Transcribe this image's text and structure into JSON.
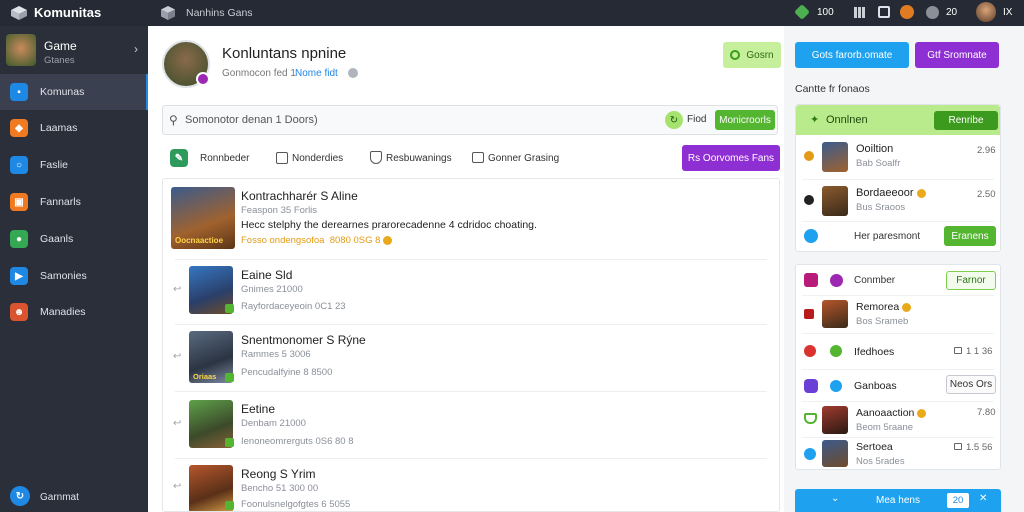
{
  "topbar": {
    "app_title": "Komunitas",
    "breadcrumb": "Nanhins Gans",
    "gem_count": "100",
    "coin_count": "20",
    "user_tag": "IX"
  },
  "sidebar": {
    "game": {
      "title": "Game",
      "subtitle": "Gtanes"
    },
    "items": [
      {
        "label": "Komunas",
        "color": "#1e88e5",
        "active": true
      },
      {
        "label": "Laamas",
        "color": "#f07a21"
      },
      {
        "label": "Faslie",
        "color": "#1e88e5"
      },
      {
        "label": "Fannarls",
        "color": "#f07a21"
      },
      {
        "label": "Gaanls",
        "color": "#34a853"
      },
      {
        "label": "Samonies",
        "color": "#1e88e5"
      },
      {
        "label": "Manadies",
        "color": "#d9542f"
      }
    ],
    "footer_label": "Garnmat"
  },
  "profile": {
    "name": "Konluntans npnine",
    "meta": "Gonmocon fed 1",
    "link": "Nome fidt",
    "green_btn": "Gosrn"
  },
  "actions": {
    "blue_btn": "Gots farorb.omate",
    "purple_btn": "Gtf Sromnate"
  },
  "search": {
    "placeholder": "Somonotor denan 1 Doors)",
    "toggle_label": "Fiod",
    "button": "Monicroorls"
  },
  "tabs": [
    {
      "label": "Ronnbeder",
      "icon": "pencil-icon"
    },
    {
      "label": "Nonderdies",
      "icon": "edit-icon"
    },
    {
      "label": "Resbuwanings",
      "icon": "shield-icon"
    },
    {
      "label": "Gonner Grasing",
      "icon": "photo-icon"
    }
  ],
  "tab_action": "Rs Oorvomes Fans",
  "feed": [
    {
      "title": "Kontrachharér S Aline",
      "sub": "Feaspon 35 Forlis",
      "desc": "Hecc stelphy the derearnes prarorecadenne 4 cdridoc choating.",
      "extra": "Fosso ondengsofoa",
      "num": "8080 0SG 8",
      "thumb_label": "Oocnaactioe"
    },
    {
      "title": "Eaine Sld",
      "sub": "Gnimes 21000",
      "desc": "Rayfordaceyeoin 0C1 23"
    },
    {
      "title": "Snentmonomer S Rýne",
      "sub": "Rammes 5 3006",
      "desc": "Pencudalfyine 8 8500",
      "thumb_label": "Oriaas"
    },
    {
      "title": "Eetine",
      "sub": "Denbam 21000",
      "desc": "Ienoneomrerguts 0S6 80 8"
    },
    {
      "title": "Reong S Yrim",
      "sub": "Bencho 51 300 00",
      "desc": "Foonulsnelgofgtes 6 5055"
    }
  ],
  "right": {
    "heading": "Cantte fr fonaos",
    "card1": {
      "title": "Onnlnen",
      "btn": "Renribe",
      "rows": [
        {
          "title": "Ooiltion",
          "sub": "Bab Soalfr",
          "num": "2.96",
          "gold": false
        },
        {
          "title": "Bordaeeoor",
          "sub": "Bus Sraoos",
          "num": "2.50",
          "gold": true
        }
      ],
      "footer": {
        "label": "Her paresmont",
        "btn": "Eranens"
      }
    },
    "card2": {
      "title": "Conmber",
      "btn": "Farnor",
      "rows": [
        {
          "title": "Remorea",
          "sub": "Bos Srameb",
          "num": "",
          "gold": true
        },
        {
          "title": "Ifedhoes",
          "sub": "",
          "num": "1 1 36",
          "gold": false
        },
        {
          "title": "Ganboas",
          "sub": "",
          "num": "Neos Ors",
          "gold": false
        },
        {
          "title": "Aanoaaction",
          "sub": "Beom 5raane",
          "num": "7.80",
          "gold": true
        },
        {
          "title": "Sertoea",
          "sub": "Nos 5rades",
          "num": "1.5 56",
          "gold": false
        }
      ]
    },
    "bottom_btn": {
      "label": "Mea hens",
      "num": "20"
    }
  }
}
